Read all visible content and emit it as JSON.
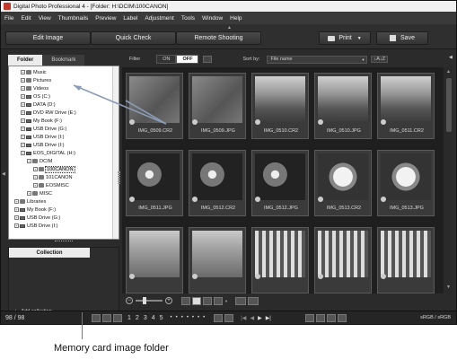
{
  "window": {
    "title": "Digital Photo Professional 4 - [Folder: H:\\DCIM\\100CANON]"
  },
  "menu": [
    "File",
    "Edit",
    "View",
    "Thumbnails",
    "Preview",
    "Label",
    "Adjustment",
    "Tools",
    "Window",
    "Help"
  ],
  "toolbar": {
    "edit_image": "Edit Image",
    "quick_check": "Quick Check",
    "remote_shooting": "Remote Shooting",
    "print": "Print",
    "save": "Save"
  },
  "filter": {
    "label": "Filter",
    "on": "ON",
    "off": "OFF",
    "sort_label": "Sort by:",
    "sort_value": "File name",
    "sort_order": "↓A↓Z"
  },
  "left_tabs": {
    "folder": "Folder",
    "bookmark": "Bookmark"
  },
  "tree": [
    {
      "label": "Music",
      "indent": 1,
      "kind": "folder"
    },
    {
      "label": "Pictures",
      "indent": 1,
      "kind": "folder"
    },
    {
      "label": "Videos",
      "indent": 1,
      "kind": "folder"
    },
    {
      "label": "OS (C:)",
      "indent": 1,
      "kind": "drive"
    },
    {
      "label": "DATA (D:)",
      "indent": 1,
      "kind": "drive"
    },
    {
      "label": "DVD RW Drive (E:)",
      "indent": 1,
      "kind": "drive"
    },
    {
      "label": "My Book (F:)",
      "indent": 1,
      "kind": "drive"
    },
    {
      "label": "USB Drive (G:)",
      "indent": 1,
      "kind": "drive"
    },
    {
      "label": "USB Drive (I:)",
      "indent": 1,
      "kind": "drive"
    },
    {
      "label": "USB Drive (I:)",
      "indent": 1,
      "kind": "drive"
    },
    {
      "label": "EOS_DIGITAL (H:)",
      "indent": 1,
      "kind": "drive"
    },
    {
      "label": "DCIM",
      "indent": 2,
      "kind": "folder"
    },
    {
      "label": "100CANON",
      "indent": 3,
      "kind": "folder",
      "selected": true
    },
    {
      "label": "101CANON",
      "indent": 3,
      "kind": "folder"
    },
    {
      "label": "EOSMISC",
      "indent": 3,
      "kind": "folder"
    },
    {
      "label": "MISC",
      "indent": 2,
      "kind": "folder"
    },
    {
      "label": "Libraries",
      "indent": 0,
      "kind": "folder"
    },
    {
      "label": "My Book (F:)",
      "indent": 0,
      "kind": "drive"
    },
    {
      "label": "USB Drive (G:)",
      "indent": 0,
      "kind": "drive"
    },
    {
      "label": "USB Drive (I:)",
      "indent": 0,
      "kind": "drive"
    }
  ],
  "collection": {
    "title": "Collection",
    "add": "Add collection"
  },
  "thumbnails": [
    {
      "name": "IMG_0509.CR2",
      "tone": "gray"
    },
    {
      "name": "IMG_0509.JPG",
      "tone": "gray"
    },
    {
      "name": "IMG_0510.CR2",
      "tone": "street"
    },
    {
      "name": "IMG_0510.JPG",
      "tone": "street"
    },
    {
      "name": "IMG_0511.CR2",
      "tone": "street"
    },
    {
      "name": "IMG_0511.JPG",
      "tone": "flower"
    },
    {
      "name": "IMG_0512.CR2",
      "tone": "flower"
    },
    {
      "name": "IMG_0512.JPG",
      "tone": "flower"
    },
    {
      "name": "IMG_0513.CR2",
      "tone": "daisy"
    },
    {
      "name": "IMG_0513.JPG",
      "tone": "daisy"
    },
    {
      "name": "",
      "tone": "building"
    },
    {
      "name": "",
      "tone": "building"
    },
    {
      "name": "",
      "tone": "awning"
    },
    {
      "name": "",
      "tone": "awning"
    },
    {
      "name": "",
      "tone": "awning"
    }
  ],
  "status": {
    "count": "98 / 98",
    "color_space": "sRGB / sRGB",
    "ratings": [
      "1",
      "2",
      "3",
      "4",
      "5"
    ]
  },
  "caption": "Memory card image folder"
}
